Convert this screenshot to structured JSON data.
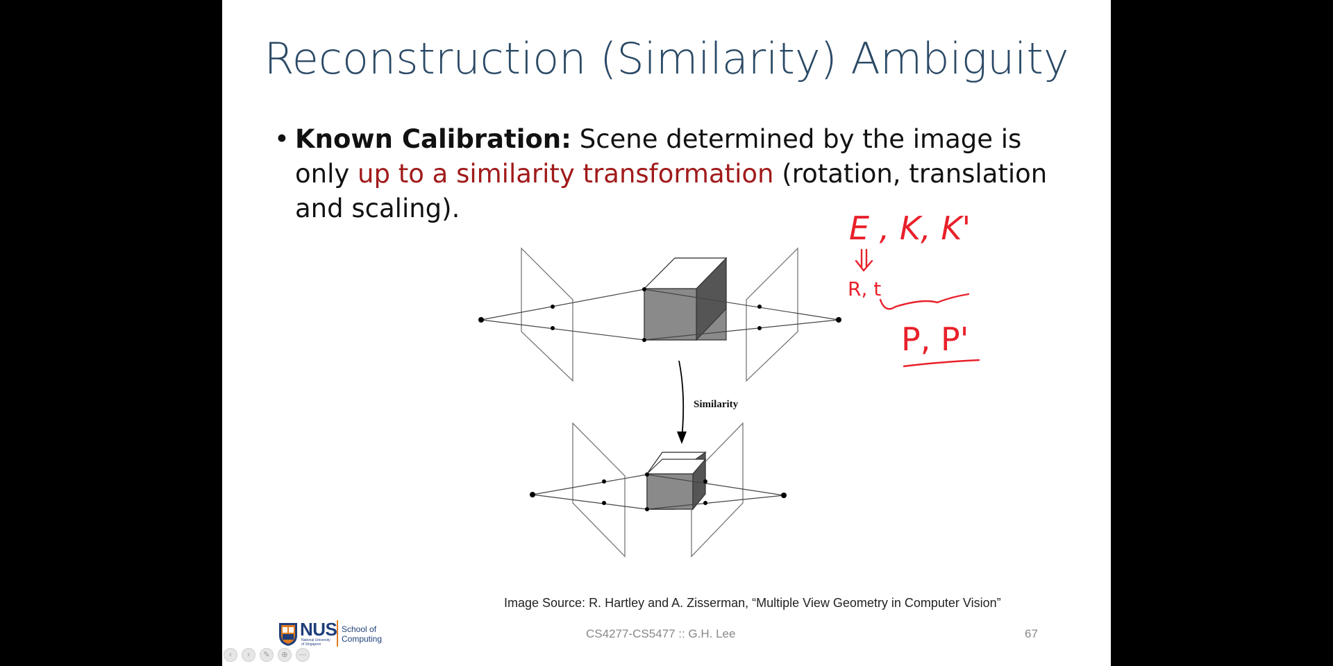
{
  "slide": {
    "title": "Reconstruction (Similarity) Ambiguity",
    "bullet": {
      "marker": "•",
      "bold_lead": "Known Calibration:",
      "text_part1": " Scene determined by the image is only ",
      "highlight": "up to a similarity transformation",
      "text_part2": " (rotation, translation and scaling)."
    },
    "diagram": {
      "arrow_label": "Similarity"
    },
    "handwriting": {
      "line1": "E , K, K'",
      "line2": "R, t",
      "line3": "P, P'"
    },
    "credit": "Image Source: R. Hartley and A. Zisserman, “Multiple View Geometry in Computer Vision”",
    "footer": {
      "course": "CS4277-CS5477 :: G.H. Lee",
      "page_number": "67"
    },
    "logo": {
      "brand": "NUS",
      "sub": "National University of Singapore",
      "school_line1": "School of",
      "school_line2": "Computing"
    }
  },
  "colors": {
    "title": "#2b4a66",
    "highlight": "#a11a1a",
    "ink": "#e8202a",
    "cube_front": "#8a8a8a",
    "cube_side": "#555555",
    "cube_top": "#ffffff"
  }
}
